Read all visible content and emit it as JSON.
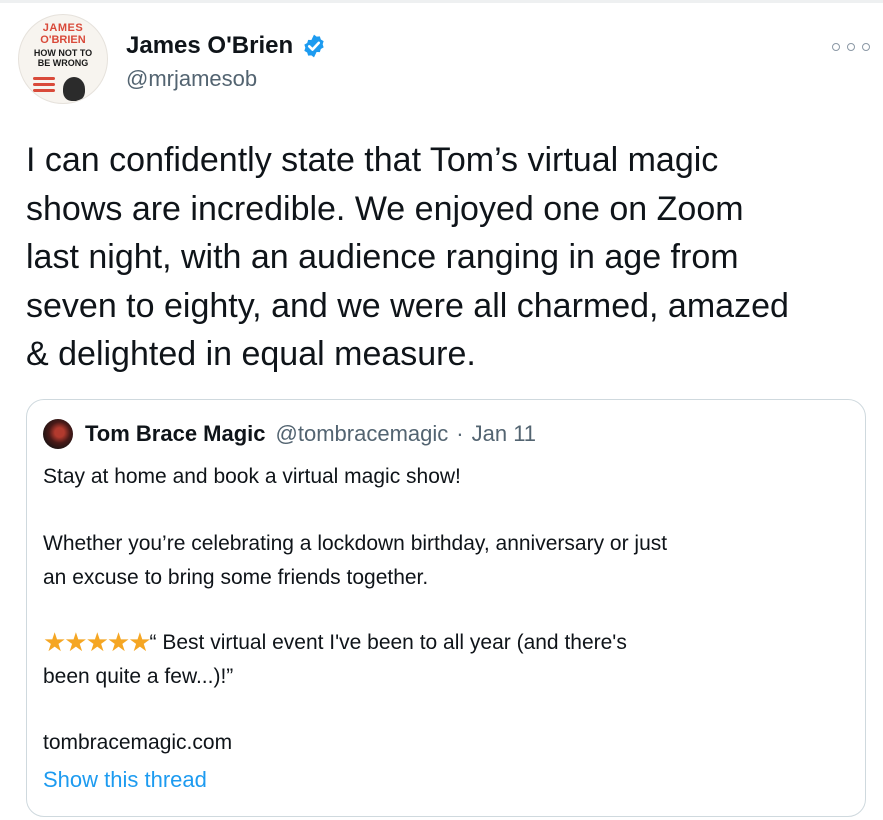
{
  "tweet": {
    "author_name": "James O'Brien",
    "author_handle": "@mrjamesob",
    "avatar_text": [
      "JAMES",
      "O'BRIEN",
      "HOW NOT TO",
      "BE WRONG"
    ],
    "verified_color": "#1d9bf0",
    "text_lines": [
      "I can confidently state that Tom’s virtual magic",
      "shows are incredible. We enjoyed one on Zoom",
      "last night, with an audience ranging in age from",
      "seven to eighty, and we were all charmed, amazed",
      "& delighted in equal measure."
    ]
  },
  "quoted": {
    "author_name": "Tom Brace Magic",
    "author_handle": "@tombracemagic",
    "separator": "·",
    "date": "Jan 11",
    "line1": "Stay at home and book a virtual magic show!",
    "para2_lines": [
      "Whether you’re celebrating a lockdown birthday, anniversary or just",
      "an excuse to bring some friends together."
    ],
    "stars": "★★★★★",
    "review_line1": "“ Best virtual event I've been to all year (and there's",
    "review_line2": "been quite a few...)!”",
    "link": "tombracemagic.com",
    "show_thread": "Show this thread"
  },
  "colors": {
    "link_blue": "#1d9bf0",
    "secondary_text": "#536471",
    "star_gold": "#f5a623"
  }
}
